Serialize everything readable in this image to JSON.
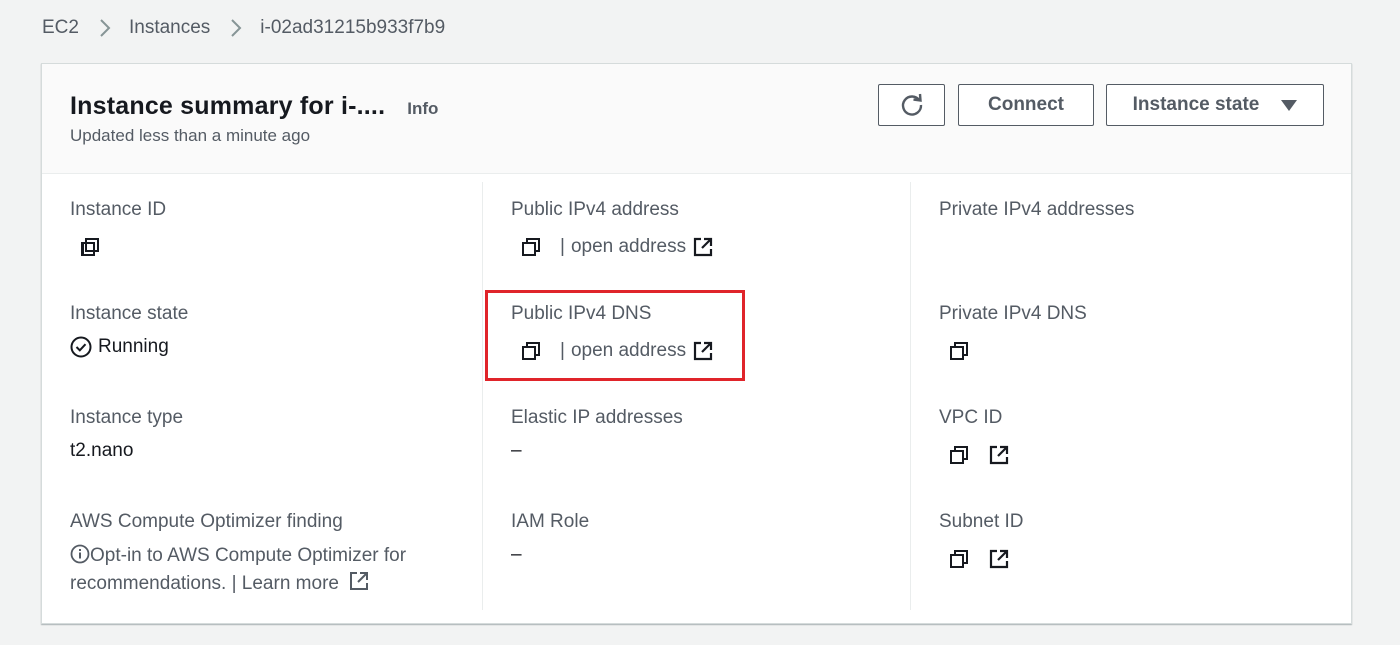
{
  "breadcrumb": {
    "items": [
      "EC2",
      "Instances"
    ],
    "current": "i-02ad31215b933f7b9"
  },
  "header": {
    "title": "Instance summary for i-....",
    "info_label": "Info",
    "subtitle": "Updated less than a minute ago",
    "connect_label": "Connect",
    "instance_state_label": "Instance state"
  },
  "fields": {
    "instance_id": {
      "label": "Instance ID"
    },
    "public_ipv4_address": {
      "label": "Public IPv4 address",
      "separator": "|",
      "link": "open address"
    },
    "private_ipv4_addresses": {
      "label": "Private IPv4 addresses"
    },
    "instance_state": {
      "label": "Instance state",
      "value": "Running"
    },
    "public_ipv4_dns": {
      "label": "Public IPv4 DNS",
      "separator": "|",
      "link": "open address"
    },
    "private_ipv4_dns": {
      "label": "Private IPv4 DNS"
    },
    "instance_type": {
      "label": "Instance type",
      "value": "t2.nano"
    },
    "elastic_ip_addresses": {
      "label": "Elastic IP addresses",
      "value": "–"
    },
    "vpc_id": {
      "label": "VPC ID"
    },
    "compute_optimizer": {
      "label": "AWS Compute Optimizer finding",
      "text": "Opt-in to AWS Compute Optimizer for recommendations.",
      "separator": "|",
      "link": "Learn more"
    },
    "iam_role": {
      "label": "IAM Role",
      "value": "–"
    },
    "subnet_id": {
      "label": "Subnet ID"
    }
  },
  "icons": {
    "copy": "copy-icon",
    "external": "external-link-icon",
    "refresh": "refresh-icon",
    "status": "check-circle-icon",
    "info": "info-circle-icon"
  },
  "colors": {
    "text_primary": "#16191f",
    "text_secondary": "#545b64",
    "highlight_border": "#e0242a",
    "background": "#f2f3f3"
  }
}
